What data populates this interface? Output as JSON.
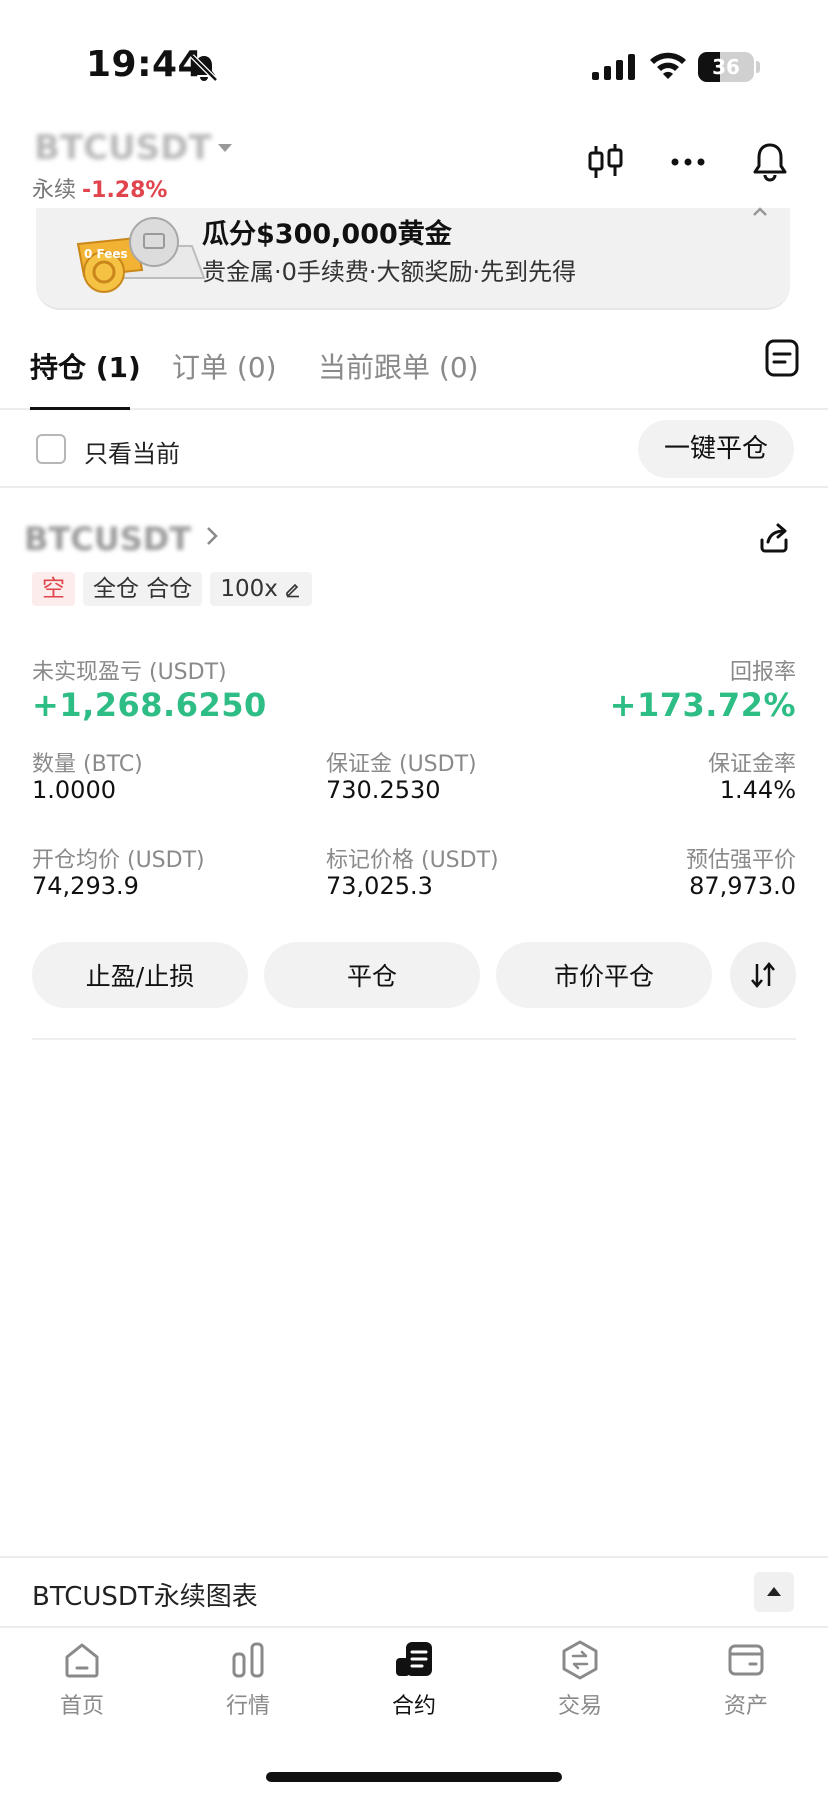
{
  "status_bar": {
    "time": "19:44",
    "battery": "36"
  },
  "header": {
    "symbol": "BTCUSDT",
    "contract_type": "永续",
    "change": "-1.28%",
    "icons": [
      "candlestick-icon",
      "more-icon",
      "bell-icon"
    ]
  },
  "banner": {
    "title": "瓜分$300,000黄金",
    "subtitle": "贵金属·0手续费·大额奖励·先到先得",
    "graphic_text": "0 Fees"
  },
  "tabs": [
    {
      "label": "持仓 (1)",
      "active": true
    },
    {
      "label": "订单 (0)",
      "active": false
    },
    {
      "label": "当前跟单 (0)",
      "active": false
    }
  ],
  "filter": {
    "label": "只看当前",
    "close_all": "一键平仓"
  },
  "position": {
    "symbol": "BTCUSDT",
    "tags": {
      "side": "空",
      "mode": "全仓 合仓",
      "leverage": "100x"
    },
    "pnl_label": "未实现盈亏 (USDT)",
    "pnl_value": "+1,268.6250",
    "roe_label": "回报率",
    "roe_value": "+173.72%",
    "qty_label": "数量 (BTC)",
    "qty_value": "1.0000",
    "margin_label": "保证金 (USDT)",
    "margin_value": "730.2530",
    "margin_ratio_label": "保证金率",
    "margin_ratio_value": "1.44%",
    "entry_label": "开仓均价 (USDT)",
    "entry_value": "74,293.9",
    "mark_label": "标记价格 (USDT)",
    "mark_value": "73,025.3",
    "liq_label": "预估强平价",
    "liq_value": "87,973.0",
    "actions": {
      "tpsl": "止盈/止损",
      "close": "平仓",
      "market_close": "市价平仓"
    }
  },
  "chart_bar": {
    "label": "BTCUSDT永续图表"
  },
  "bottom_nav": [
    {
      "label": "首页",
      "icon": "home-icon"
    },
    {
      "label": "行情",
      "icon": "markets-icon"
    },
    {
      "label": "合约",
      "icon": "futures-icon"
    },
    {
      "label": "交易",
      "icon": "trade-icon"
    },
    {
      "label": "资产",
      "icon": "wallet-icon"
    }
  ],
  "colors": {
    "up": "#2ebd85",
    "down": "#e0454d",
    "text": "#111111",
    "muted": "#8a8a8a"
  }
}
